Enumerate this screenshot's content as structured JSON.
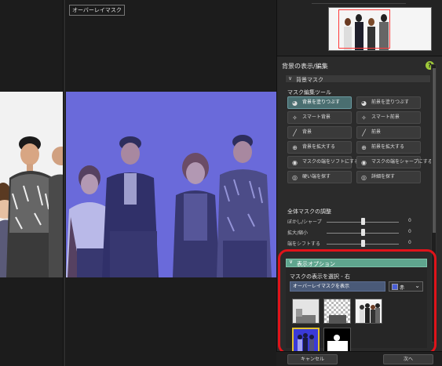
{
  "viewer": {
    "pane_label": "オーバーレイマスク"
  },
  "panel": {
    "section_title": "背景の表示/編集",
    "help_icon": "?",
    "mask_header": "背景マスク",
    "tools_title": "マスク編集ツール",
    "tools": [
      {
        "label": "背景を塗りつぶす",
        "icon": "fill-bucket-icon",
        "glyph": "◕",
        "active": true
      },
      {
        "label": "前景を塗りつぶす",
        "icon": "fill-bucket-icon",
        "glyph": "◕",
        "active": false
      },
      {
        "label": "スマート背景",
        "icon": "smart-brush-icon",
        "glyph": "✧",
        "active": false
      },
      {
        "label": "スマート前景",
        "icon": "smart-brush-icon",
        "glyph": "✧",
        "active": false
      },
      {
        "label": "背景",
        "icon": "brush-icon",
        "glyph": "╱",
        "active": false
      },
      {
        "label": "前景",
        "icon": "brush-icon",
        "glyph": "╱",
        "active": false
      },
      {
        "label": "背景を拡大する",
        "icon": "expand-icon",
        "glyph": "⊕",
        "active": false
      },
      {
        "label": "前景を拡大する",
        "icon": "expand-icon",
        "glyph": "⊕",
        "active": false
      },
      {
        "label": "マスクの端をソフトにする",
        "icon": "soften-edge-icon",
        "glyph": "◉",
        "active": false
      },
      {
        "label": "マスクの端をシャープにする",
        "icon": "sharpen-edge-icon",
        "glyph": "◉",
        "active": false
      },
      {
        "label": "硬い端を探す",
        "icon": "find-edge-icon",
        "glyph": "◎",
        "active": false
      },
      {
        "label": "詳細を探す",
        "icon": "find-detail-icon",
        "glyph": "◎",
        "active": false
      }
    ],
    "adjust_title": "全体マスクの調整",
    "adjustments": [
      {
        "label": "ぼかし/シャープ",
        "value": "0",
        "level": 0.5
      },
      {
        "label": "拡大/縮小",
        "value": "0",
        "level": 0.5
      },
      {
        "label": "端をシフトする",
        "value": "0",
        "level": 0.5
      }
    ]
  },
  "display": {
    "header": "表示オプション",
    "select_label": "マスクの表示を選択 - 右",
    "mode_value": "オーバーレイマスクを表示",
    "color_value": "赤",
    "color_hex": "#4a5fd8"
  },
  "footer": {
    "cancel_label": "キャンセル",
    "next_label": "次へ"
  }
}
